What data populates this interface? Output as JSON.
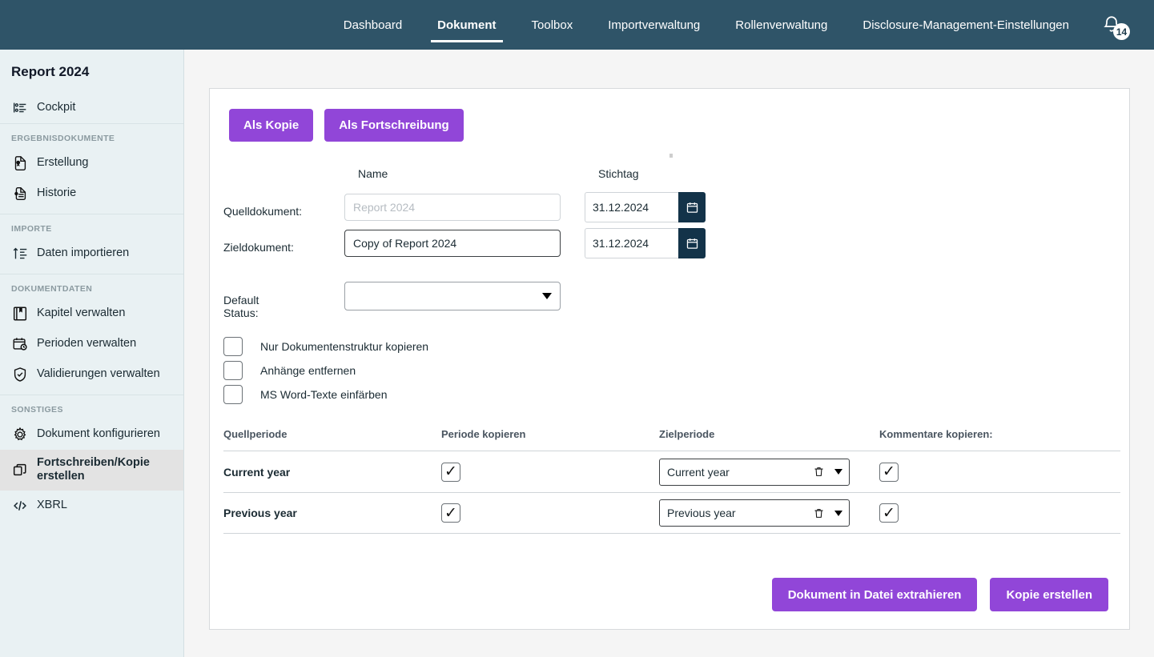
{
  "header": {
    "nav": [
      {
        "label": "Dashboard",
        "active": false
      },
      {
        "label": "Dokument",
        "active": true
      },
      {
        "label": "Toolbox",
        "active": false
      },
      {
        "label": "Importverwaltung",
        "active": false
      },
      {
        "label": "Rollenverwaltung",
        "active": false
      },
      {
        "label": "Disclosure-Management-Einstellungen",
        "active": false
      }
    ],
    "notifications": {
      "icon": "bell-icon",
      "count": "14"
    },
    "bg_color": "#2f5468"
  },
  "sidebar": {
    "title": "Report 2024",
    "bg_color": "#e9f1f3",
    "top_items": [
      {
        "label": "Cockpit",
        "icon": "cockpit-icon"
      }
    ],
    "groups": [
      {
        "label": "ERGEBNISDOKUMENTE",
        "items": [
          {
            "label": "Erstellung",
            "icon": "document-badge-icon"
          },
          {
            "label": "Historie",
            "icon": "document-history-icon"
          }
        ]
      },
      {
        "label": "IMPORTE",
        "items": [
          {
            "label": "Daten importieren",
            "icon": "import-arrow-icon"
          }
        ]
      },
      {
        "label": "DOKUMENTDATEN",
        "items": [
          {
            "label": "Kapitel verwalten",
            "icon": "book-icon"
          },
          {
            "label": "Perioden verwalten",
            "icon": "calendar-clock-icon"
          },
          {
            "label": "Validierungen verwalten",
            "icon": "shield-check-icon"
          }
        ]
      },
      {
        "label": "SONSTIGES",
        "items": [
          {
            "label": "Dokument konfigurieren",
            "icon": "gear-icon",
            "active": false
          },
          {
            "label": "Fortschreiben/Kopie erstellen",
            "icon": "copy-icon",
            "active": true
          },
          {
            "label": "XBRL",
            "icon": "code-icon",
            "active": false
          }
        ]
      }
    ]
  },
  "main": {
    "mode_tabs": [
      {
        "label": "Als Kopie"
      },
      {
        "label": "Als Fortschreibung"
      }
    ],
    "accent_color": "#9146d8",
    "form": {
      "col_name_label": "Name",
      "col_date_label": "Stichtag",
      "source": {
        "row_label": "Quelldokument:",
        "name_value": "",
        "name_placeholder": "Report 2024",
        "date_value": "31.12.2024",
        "date_icon": "calendar-icon"
      },
      "target": {
        "row_label": "Zieldokument:",
        "name_value": "Copy of Report 2024",
        "name_placeholder": "",
        "date_value": "31.12.2024",
        "date_icon": "calendar-icon"
      },
      "default_status": {
        "row_label": "Default Status:",
        "value": ""
      }
    },
    "checkboxes": [
      {
        "label": "Nur Dokumentenstruktur kopieren",
        "checked": false
      },
      {
        "label": "Anhänge entfernen",
        "checked": false
      },
      {
        "label": "MS Word-Texte einfärben",
        "checked": false
      }
    ],
    "table": {
      "columns": [
        "Quellperiode",
        "Periode kopieren",
        "Zielperiode",
        "Kommentare kopieren:"
      ],
      "rows": [
        {
          "source_period": "Current year",
          "copy_period_checked": true,
          "target_period": "Current year",
          "target_delete_icon": "trash-icon",
          "copy_comments_checked": true
        },
        {
          "source_period": "Previous year",
          "copy_period_checked": true,
          "target_period": "Previous year",
          "target_delete_icon": "trash-icon",
          "copy_comments_checked": true
        }
      ]
    },
    "actions": [
      {
        "label": "Dokument in Datei extrahieren"
      },
      {
        "label": "Kopie erstellen"
      }
    ]
  }
}
